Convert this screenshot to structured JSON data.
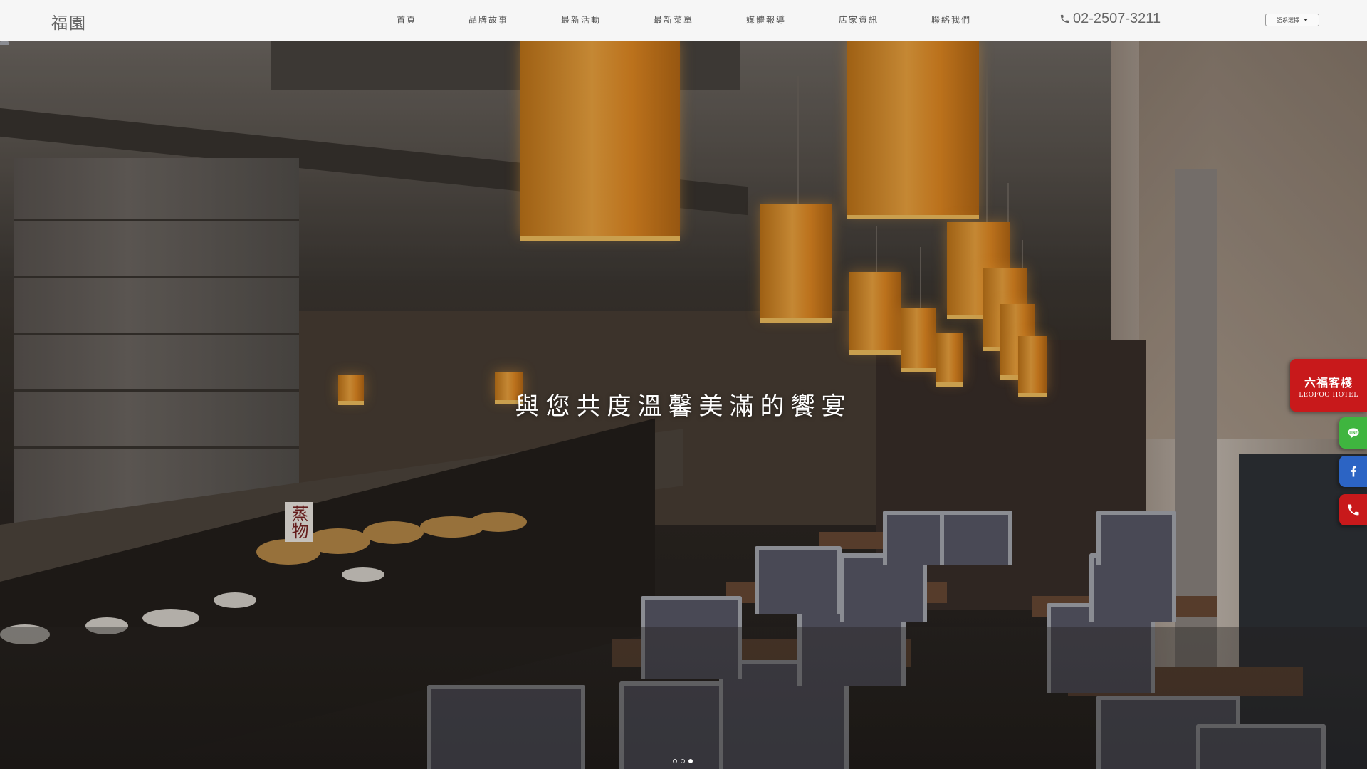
{
  "brand": {
    "logo_text": "福園"
  },
  "nav": {
    "items": [
      {
        "label": "首頁"
      },
      {
        "label": "品牌故事"
      },
      {
        "label": "最新活動"
      },
      {
        "label": "最新菜單"
      },
      {
        "label": "媒體報導"
      },
      {
        "label": "店家資訊"
      },
      {
        "label": "聯絡我們"
      }
    ]
  },
  "contact": {
    "phone_icon": "phone-icon",
    "phone": "02-2507-3211"
  },
  "language": {
    "selected": "語系選擇"
  },
  "hero": {
    "tagline": "與您共度溫馨美滿的饗宴",
    "signboard": "蒸物",
    "slides_total": 3,
    "active_slide": 3
  },
  "side": {
    "hotel_zh": "六福客棧",
    "hotel_en": "LEOFOO HOTEL",
    "line_icon": "line-icon",
    "line_color": "#3fb53f",
    "facebook_icon": "facebook-icon",
    "facebook_color": "#2c64c4",
    "phone_icon": "phone-icon",
    "phone_color": "#c8191b"
  },
  "colors": {
    "header_bg": "#f6f6f6",
    "accent_red": "#c8191b"
  }
}
